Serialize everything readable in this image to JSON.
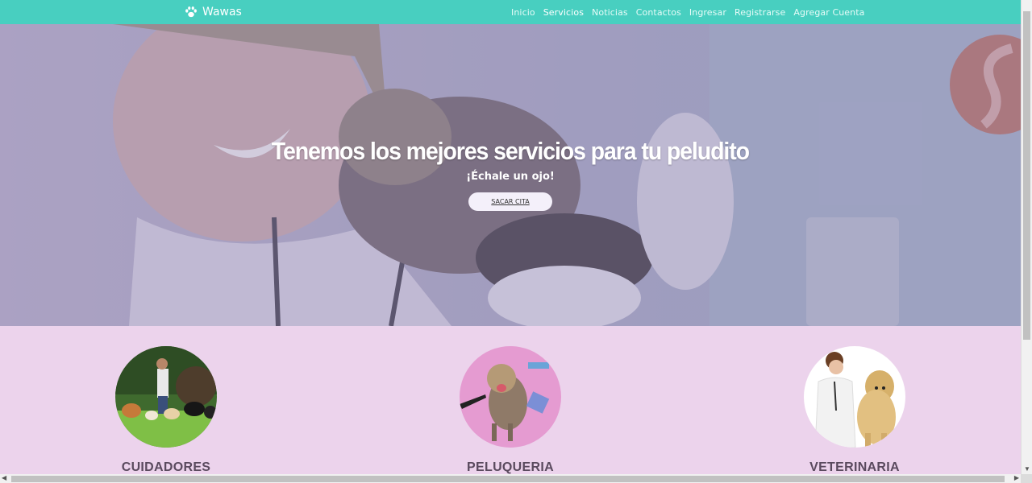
{
  "navbar": {
    "brand": "Wawas",
    "brand_icon": "paw-icon",
    "links": [
      "Inicio",
      "Servicios",
      "Noticias",
      "Contactos",
      "Ingresar",
      "Registrarse",
      "Agregar Cuenta"
    ],
    "active": "Servicios",
    "bg_color": "#48cfc0"
  },
  "hero": {
    "title": "Tenemos los mejores servicios para tu peludito",
    "subtitle": "¡Échale un ojo!",
    "button": "SACAR CITA"
  },
  "services": [
    {
      "label": "CUIDADORES"
    },
    {
      "label": "PELUQUERIA"
    },
    {
      "label": "VETERINARIA"
    }
  ],
  "colors": {
    "section_bg": "#ecd3ec",
    "label": "#5a4a5e"
  }
}
